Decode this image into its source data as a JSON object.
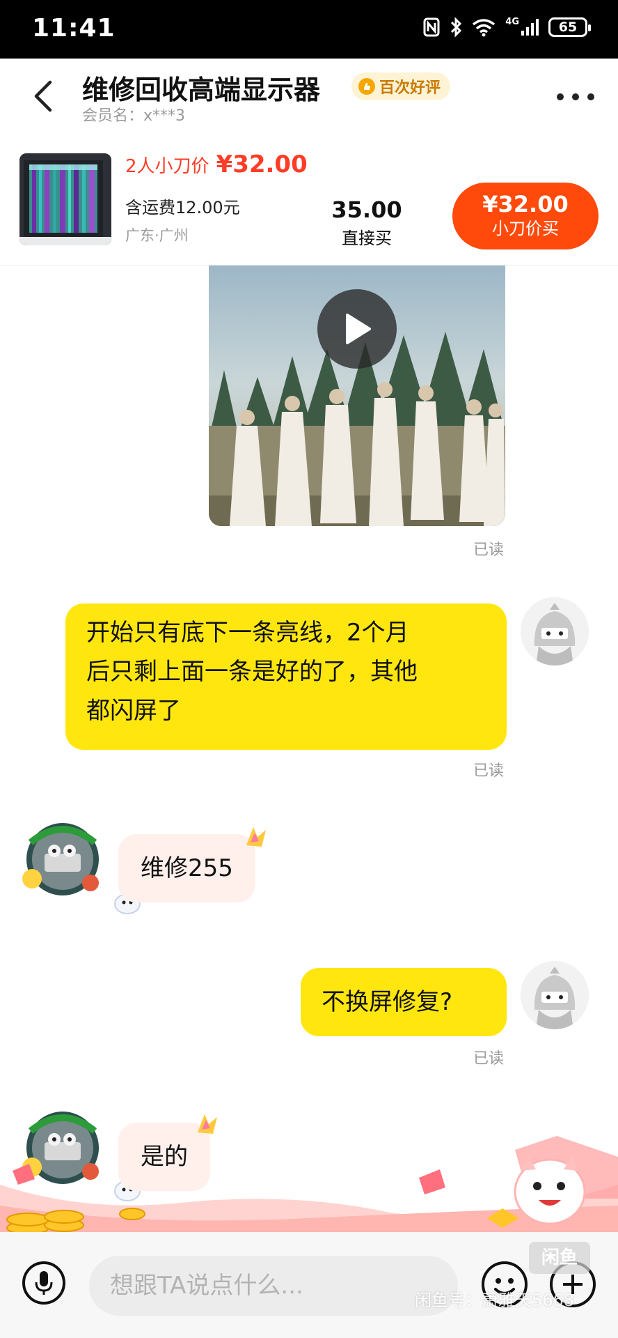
{
  "status_bar": {
    "time": "11:41",
    "network": "4G",
    "battery": "65"
  },
  "header": {
    "title": "维修回收高端显示器",
    "badge": "百次好评",
    "member_label": "会员名：",
    "member_name": "x***3"
  },
  "product": {
    "bargain_label": "2人小刀价",
    "bargain_price": "¥32.00",
    "shipping": "含运费12.00元",
    "location": "广东·广州",
    "direct_price": "35.00",
    "direct_label": "直接买",
    "button_price": "¥32.00",
    "button_label": "小刀价买"
  },
  "chat": {
    "read_label": "已读",
    "messages": [
      {
        "from": "me",
        "type": "video"
      },
      {
        "from": "me",
        "text_lines": [
          "开始只有底下一条亮线，2个月",
          "后只剩上面一条是好的了，其他",
          "都闪屏了"
        ]
      },
      {
        "from": "peer",
        "text": "维修255"
      },
      {
        "from": "me",
        "text": "不换屏修复?"
      },
      {
        "from": "peer",
        "text": "是的"
      }
    ]
  },
  "input": {
    "placeholder": "想跟TA说点什么...",
    "watermark": "闲鱼号：萧雅天5668",
    "watermark_logo": "闲鱼"
  },
  "colors": {
    "accent": "#ff4a0c",
    "price_red": "#ff3c26",
    "my_bubble": "#ffe60f",
    "peer_bubble": "#fff0ec"
  }
}
